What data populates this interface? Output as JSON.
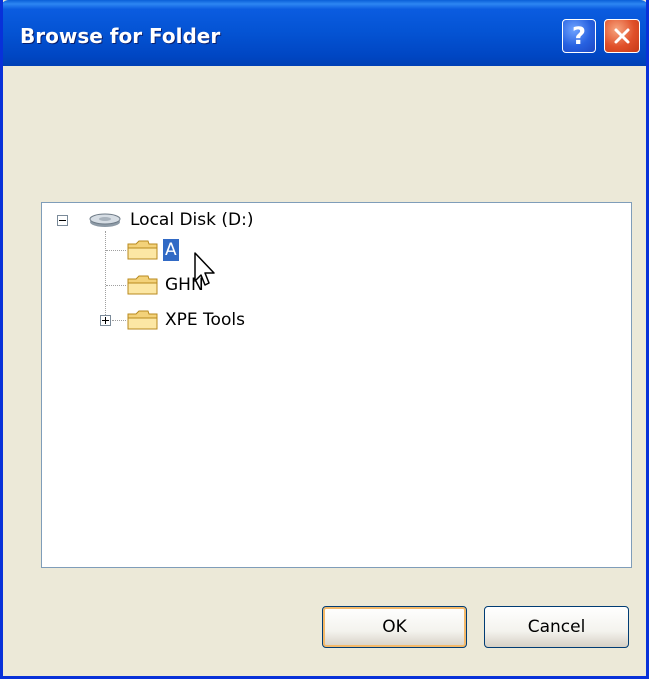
{
  "window": {
    "title": "Browse for Folder",
    "help_label": "?",
    "close_icon": "close-icon",
    "help_icon": "help-icon"
  },
  "tree": {
    "root": {
      "label": "Local Disk (D:)",
      "icon": "drive-icon",
      "expanded": true
    },
    "children": [
      {
        "label": "A",
        "icon": "folder-icon",
        "selected": true
      },
      {
        "label": "GHN",
        "icon": "folder-icon",
        "selected": false
      },
      {
        "label": "XPE Tools",
        "icon": "folder-icon",
        "selected": false,
        "has_children": true
      }
    ]
  },
  "buttons": {
    "ok_label": "OK",
    "cancel_label": "Cancel"
  },
  "colors": {
    "title_bar": "#0453D3",
    "selection": "#316AC5",
    "window_bg": "#ECE9D8",
    "close_button": "#E0502A"
  }
}
